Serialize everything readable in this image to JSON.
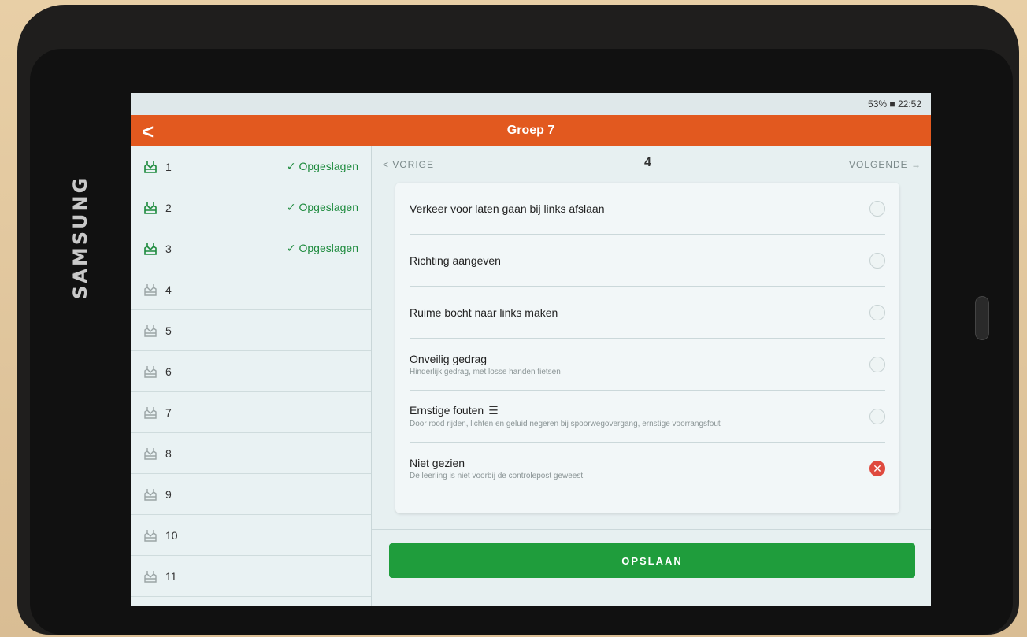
{
  "device": {
    "brand": "SAMSUNG"
  },
  "status_bar": {
    "text": "53% ■ 22:52"
  },
  "app_bar": {
    "back": "<",
    "title": "Groep 7"
  },
  "sidebar": {
    "items": [
      {
        "label": "1",
        "status": "✓ Opgeslagen"
      },
      {
        "label": "2",
        "status": "✓ Opgeslagen"
      },
      {
        "label": "3",
        "status": "✓ Opgeslagen"
      },
      {
        "label": "4",
        "status": ""
      },
      {
        "label": "5",
        "status": ""
      },
      {
        "label": "6",
        "status": ""
      },
      {
        "label": "7",
        "status": ""
      },
      {
        "label": "8",
        "status": ""
      },
      {
        "label": "9",
        "status": ""
      },
      {
        "label": "10",
        "status": ""
      },
      {
        "label": "11",
        "status": ""
      }
    ]
  },
  "nav": {
    "prev": "< VORIGE",
    "page": "4",
    "next": "VOLGENDE →"
  },
  "questions": [
    {
      "label": "Verkeer voor laten gaan bij links afslaan",
      "sub": ""
    },
    {
      "label": "Richting aangeven",
      "sub": ""
    },
    {
      "label": "Ruime bocht naar links maken",
      "sub": ""
    },
    {
      "label": "Onveilig gedrag",
      "sub": "Hinderlijk gedrag, met losse handen fietsen"
    },
    {
      "label": "Ernstige fouten",
      "sub": "Door rood rijden, lichten en geluid negeren bij spoorwegovergang, ernstige voorrangsfout"
    },
    {
      "label": "Niet gezien",
      "sub": "De leerling is niet voorbij de controlepost geweest."
    }
  ],
  "save": {
    "label": "OPSLAAN"
  },
  "colors": {
    "accent": "#e2591f",
    "success": "#1f9d3c",
    "error": "#df4a3f"
  }
}
